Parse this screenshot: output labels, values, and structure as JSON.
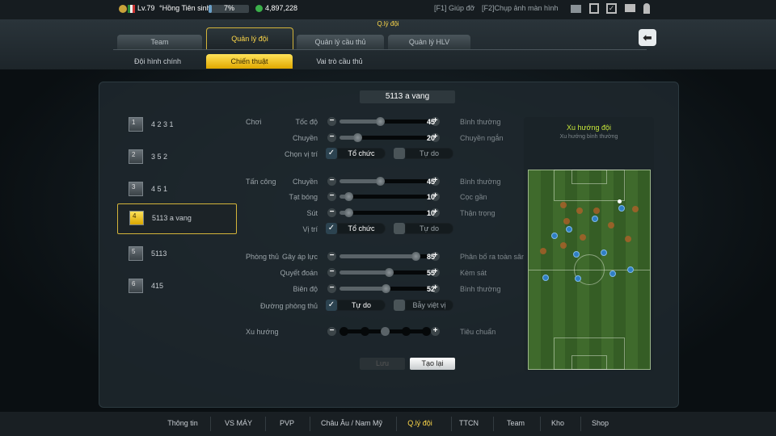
{
  "topbar": {
    "level": "Lv.79",
    "name": "°Hồng Tiên sinh°",
    "exp": "7%",
    "exp_fraction": 0.07,
    "coins": "4,897,228",
    "help": "[F1] Giúp đỡ",
    "screenshot": "[F2]Chụp ảnh màn hình"
  },
  "header": {
    "title": "Q.lý đội",
    "tabs": [
      "Team",
      "Quản lý đội",
      "Quản lý cầu thủ",
      "Quản lý HLV"
    ],
    "subtabs": [
      "Đội hình chính",
      "Chiến thuật",
      "Vai trò cầu thủ"
    ]
  },
  "tactic_name": "5113 a vang",
  "formations": [
    {
      "num": "1",
      "label": "4 2 3 1"
    },
    {
      "num": "2",
      "label": "3 5 2"
    },
    {
      "num": "3",
      "label": "4 5 1"
    },
    {
      "num": "4",
      "label": "5113 a vang"
    },
    {
      "num": "5",
      "label": "5113"
    },
    {
      "num": "6",
      "label": "415"
    }
  ],
  "groups": {
    "play": "Chơi",
    "attack": "Tấn công",
    "defense": "Phòng thủ",
    "trend": "Xu hướng"
  },
  "sliders": [
    {
      "label": "Tốc độ",
      "value": 45,
      "desc": "Bình thường"
    },
    {
      "label": "Chuyền",
      "value": 20,
      "desc": "Chuyền ngắn"
    },
    {
      "label": "Chuyền",
      "value": 45,
      "desc": "Bình thường"
    },
    {
      "label": "Tạt bóng",
      "value": 10,
      "desc": "Cọc gần"
    },
    {
      "label": "Sút",
      "value": 10,
      "desc": "Thận trọng"
    },
    {
      "label": "Gây áp lực",
      "value": 85,
      "desc": "Phân bố ra toàn sân"
    },
    {
      "label": "Quyết đoán",
      "value": 55,
      "desc": "Kèm sát"
    },
    {
      "label": "Biên độ",
      "value": 52,
      "desc": "Bình thường"
    }
  ],
  "toggles": [
    {
      "label": "Chọn vị trí",
      "on": "Tổ chức",
      "off": "Tự do"
    },
    {
      "label": "Vị trí",
      "on": "Tổ chức",
      "off": "Tự do"
    },
    {
      "label": "Đường phòng thủ",
      "on": "Tự do",
      "off": "Bẫy việt vị"
    }
  ],
  "trend": {
    "step": 3,
    "steps": 5,
    "desc": "Tiêu chuẩn"
  },
  "buttons": {
    "save": "Lưu",
    "reset": "Tạo lại"
  },
  "preview": {
    "title": "Xu hướng đội",
    "subtitle": "Xu hướng bình thường"
  },
  "bottom_nav": [
    "Thông tin",
    "VS MÁY",
    "PVP",
    "Châu Âu / Nam Mỹ",
    "Q.lý đội",
    "TTCN",
    "Team",
    "Kho",
    "Shop"
  ],
  "colors": {
    "accent": "#ffd94a",
    "home": "#2f7fc4",
    "away": "#be5f28"
  }
}
